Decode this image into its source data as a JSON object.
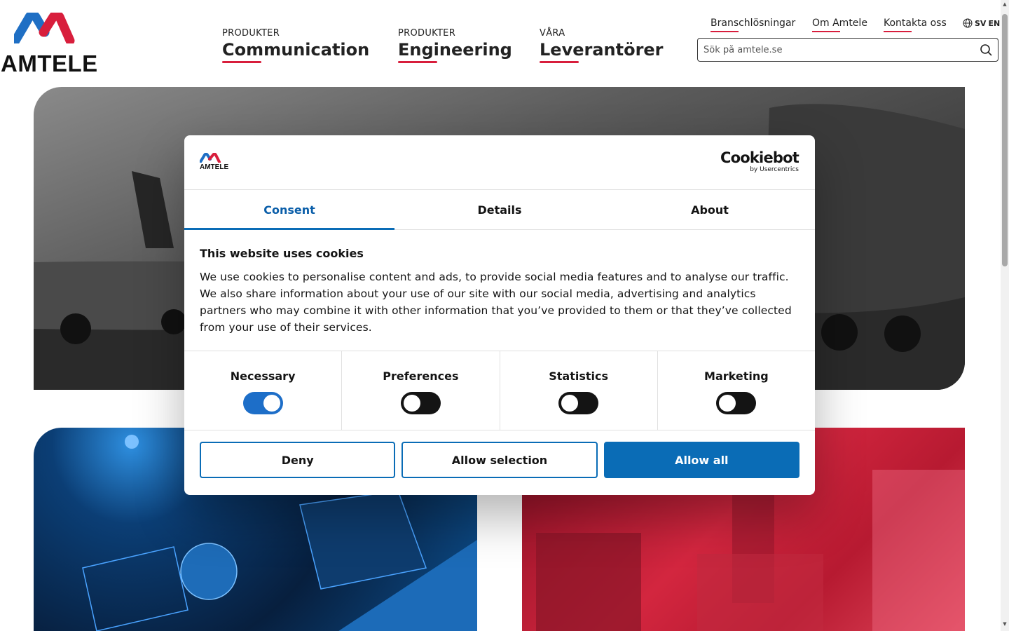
{
  "header": {
    "logo_text": "AMTELE",
    "nav_main": [
      {
        "kicker": "PRODUKTER",
        "label": "Communication"
      },
      {
        "kicker": "PRODUKTER",
        "label": "Engineering"
      },
      {
        "kicker": "VÅRA",
        "label": "Leverantörer"
      }
    ],
    "nav_top": [
      "Branschlösningar",
      "Om Amtele",
      "Kontakta oss"
    ],
    "lang": {
      "sv": "SV",
      "en": "EN"
    },
    "search_placeholder": "Sök på amtele.se"
  },
  "cookie_dialog": {
    "logo_text": "AMTELE",
    "provider_name": "Cookiebot",
    "provider_sub": "by Usercentrics",
    "tabs": [
      {
        "label": "Consent",
        "active": true
      },
      {
        "label": "Details",
        "active": false
      },
      {
        "label": "About",
        "active": false
      }
    ],
    "heading": "This website uses cookies",
    "text": "We use cookies to personalise content and ads, to provide social media features and to analyse our traffic. We also share information about your use of our site with our social media, advertising and analytics partners who may combine it with other information that you’ve provided to them or that they’ve collected from your use of their services.",
    "toggles": [
      {
        "label": "Necessary",
        "on": true
      },
      {
        "label": "Preferences",
        "on": false
      },
      {
        "label": "Statistics",
        "on": false
      },
      {
        "label": "Marketing",
        "on": false
      }
    ],
    "buttons": {
      "deny": "Deny",
      "allow_selection": "Allow selection",
      "allow_all": "Allow all"
    }
  },
  "colors": {
    "brand_red": "#d81e3c",
    "brand_blue": "#0a6cb6",
    "toggle_on": "#1d6ec8"
  }
}
